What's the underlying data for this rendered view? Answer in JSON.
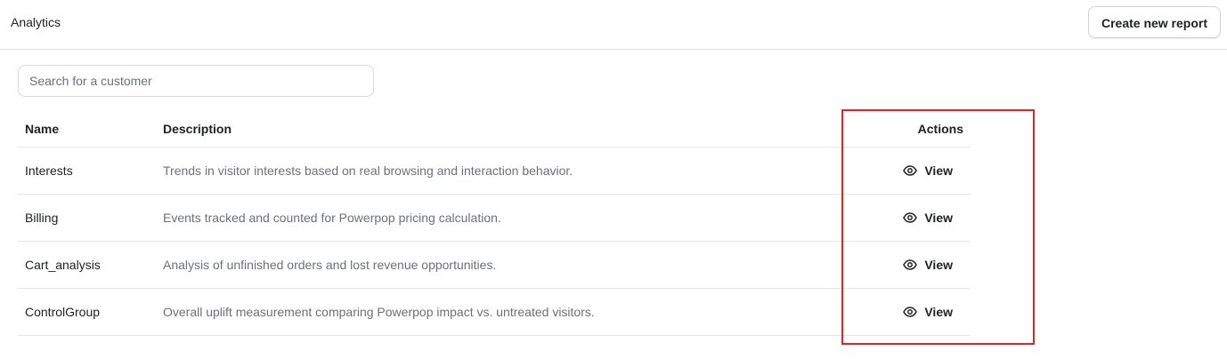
{
  "header": {
    "title": "Analytics",
    "create_button_label": "Create new report"
  },
  "search": {
    "placeholder": "Search for a customer",
    "value": ""
  },
  "table": {
    "columns": {
      "name": "Name",
      "description": "Description",
      "actions": "Actions"
    },
    "rows": [
      {
        "name": "Interests",
        "description": "Trends in visitor interests based on real browsing and interaction behavior.",
        "action_label": "View"
      },
      {
        "name": "Billing",
        "description": "Events tracked and counted for Powerpop pricing calculation.",
        "action_label": "View"
      },
      {
        "name": "Cart_analysis",
        "description": "Analysis of unfinished orders and lost revenue opportunities.",
        "action_label": "View"
      },
      {
        "name": "ControlGroup",
        "description": "Overall uplift measurement comparing Powerpop impact vs. untreated visitors.",
        "action_label": "View"
      }
    ]
  },
  "icons": {
    "view": "eye-icon"
  },
  "colors": {
    "highlight": "#e02424",
    "text_primary": "#202223",
    "text_secondary": "#6d7175"
  }
}
